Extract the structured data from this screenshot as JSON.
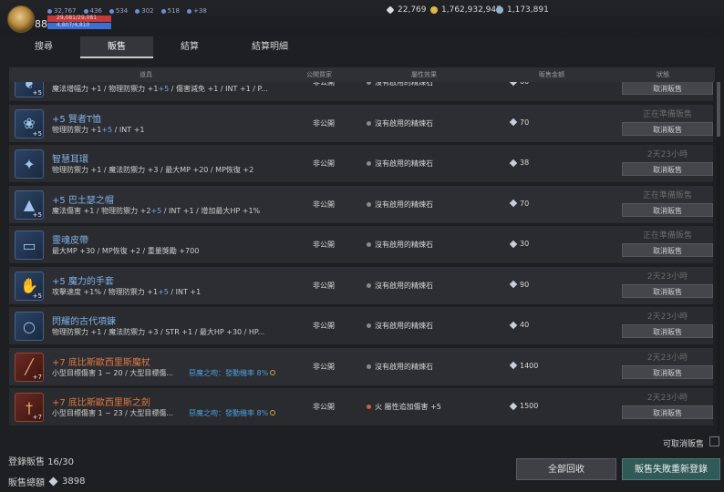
{
  "player": {
    "level": "88",
    "stats": [
      "32,767",
      "436",
      "534",
      "302",
      "518",
      "+38"
    ],
    "hp_text": "29,081/29,081",
    "mp_text": "4,807/4,810"
  },
  "currency": {
    "diamond": "22,769",
    "gold": "1,762,932,947",
    "gem": "1,173,891"
  },
  "tabs": [
    {
      "label": "搜尋"
    },
    {
      "label": "販售"
    },
    {
      "label": "結算"
    },
    {
      "label": "結算明細"
    }
  ],
  "table_headers": {
    "item": "道具",
    "public": "公開買家",
    "effect": "屬性效果",
    "price": "販售金額",
    "status": "狀態"
  },
  "rows": [
    {
      "name": "",
      "desc_pre": "魔法增幅力 +1 / 物理防禦力 +1",
      "desc_hl": "+5",
      "desc_post": " / 傷害減免 +1 / INT +1 / P...",
      "public": "非公開",
      "effect": "沒有啟用的精煉石",
      "price": "60",
      "status": "",
      "cancel": "取消販售",
      "icon": "cloak-icon",
      "enhance": "+5",
      "color": "blue"
    },
    {
      "name": "+5 賢者T恤",
      "desc_pre": "物理防禦力 +1",
      "desc_hl": "+5",
      "desc_post": " / INT +1",
      "public": "非公開",
      "effect": "沒有啟用的精煉石",
      "price": "70",
      "status": "正在準備販售",
      "cancel": "取消販售",
      "icon": "shirt-icon",
      "enhance": "+5",
      "color": "blue"
    },
    {
      "name": "智慧耳環",
      "desc_pre": "物理防禦力 +1 / 魔法防禦力 +3 / 最大MP +20 / MP恢復 +2",
      "desc_hl": "",
      "desc_post": "",
      "public": "非公開",
      "effect": "沒有啟用的精煉石",
      "price": "38",
      "status": "2天23小時",
      "cancel": "取消販售",
      "icon": "earring-icon",
      "enhance": "",
      "color": "blue"
    },
    {
      "name": "+5 巴土瑟之帽",
      "desc_pre": "魔法傷害 +1 / 物理防禦力 +2",
      "desc_hl": "+5",
      "desc_post": " / INT +1 / 增加最大HP +1%",
      "public": "非公開",
      "effect": "沒有啟用的精煉石",
      "price": "70",
      "status": "正在準備販售",
      "cancel": "取消販售",
      "icon": "hat-icon",
      "enhance": "+5",
      "color": "blue"
    },
    {
      "name": "靈魂皮帶",
      "desc_pre": "最大MP +30 / MP恢復 +2 / 重量獎勵 +700",
      "desc_hl": "",
      "desc_post": "",
      "public": "非公開",
      "effect": "沒有啟用的精煉石",
      "price": "30",
      "status": "正在準備販售",
      "cancel": "取消販售",
      "icon": "belt-icon",
      "enhance": "",
      "color": "blue"
    },
    {
      "name": "+5 魔力的手套",
      "desc_pre": "攻擊速度 +1% / 物理防禦力 +1",
      "desc_hl": "+5",
      "desc_post": " / INT +1",
      "public": "非公開",
      "effect": "沒有啟用的精煉石",
      "price": "90",
      "status": "2天23小時",
      "cancel": "取消販售",
      "icon": "glove-icon",
      "enhance": "+5",
      "color": "blue"
    },
    {
      "name": "閃耀的古代項鍊",
      "desc_pre": "物理防禦力 +1 / 魔法防禦力 +3 / STR +1 / 最大HP +30 / HP...",
      "desc_hl": "",
      "desc_post": "",
      "public": "非公開",
      "effect": "沒有啟用的精煉石",
      "price": "40",
      "status": "2天23小時",
      "cancel": "取消販售",
      "icon": "necklace-icon",
      "enhance": "",
      "color": "blue"
    },
    {
      "name": "+7 底比斯歐西里斯魔杖",
      "desc_pre": "小型目標傷害 1 ~ 20 / 大型目標傷...",
      "desc_hl": "",
      "desc_post": "",
      "set_tag": "惡魔之吻：發動機率 8%",
      "public": "非公開",
      "effect": "沒有啟用的精煉石",
      "price": "1400",
      "status": "2天23小時",
      "cancel": "取消販售",
      "icon": "staff-icon",
      "enhance": "+7",
      "color": "red"
    },
    {
      "name": "+7 底比斯歐西里斯之劍",
      "desc_pre": "小型目標傷害 1 ~ 23 / 大型目標傷...",
      "desc_hl": "",
      "desc_post": "",
      "set_tag": "惡魔之吻：發動機率 8%",
      "public": "非公開",
      "effect": "火 屬性追加傷害 +5",
      "effect_fire": true,
      "price": "1500",
      "status": "2天23小時",
      "cancel": "取消販售",
      "icon": "sword-icon",
      "enhance": "+7",
      "color": "red"
    }
  ],
  "footer": {
    "cancel_label": "可取消販售",
    "registered_label": "登錄販售",
    "registered_value": "16/30",
    "total_label": "販售總額",
    "total_value": "3898",
    "collect_all": "全部回收",
    "relist": "販售失敗重新登錄"
  }
}
